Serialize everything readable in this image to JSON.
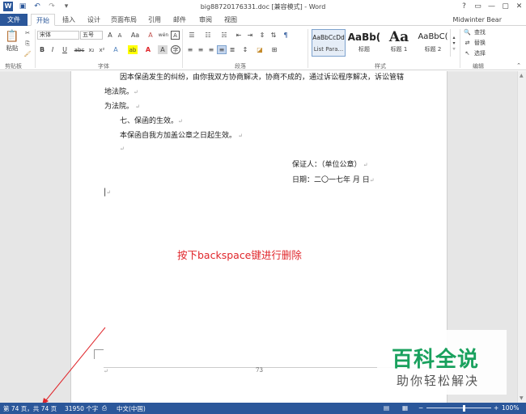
{
  "window": {
    "title": "big88720176331.doc [兼容模式] - Word",
    "controls": [
      "?",
      "▭",
      "—",
      "▢",
      "✕"
    ],
    "user": "Midwinter Bear"
  },
  "tabs": [
    {
      "label": "文件"
    },
    {
      "label": "开始"
    },
    {
      "label": "插入"
    },
    {
      "label": "设计"
    },
    {
      "label": "页面布局"
    },
    {
      "label": "引用"
    },
    {
      "label": "邮件"
    },
    {
      "label": "审阅"
    },
    {
      "label": "视图"
    }
  ],
  "ribbon": {
    "clipboard": {
      "paste": "粘贴",
      "label": "剪贴板"
    },
    "font": {
      "name": "宋体",
      "size": "五号",
      "label": "字体",
      "bold": "B",
      "italic": "I",
      "underline": "U",
      "strike": "abc",
      "sub": "x₂",
      "sup": "x²",
      "grow": "A",
      "shrink": "A",
      "case": "Aa",
      "clear": "A",
      "phonetic": "wén",
      "border": "A"
    },
    "paragraph": {
      "label": "段落"
    },
    "styles": {
      "label": "样式",
      "items": [
        {
          "preview": "AaBbCcDd",
          "name": "List Para..."
        },
        {
          "preview": "AaBb(",
          "name": "标题"
        },
        {
          "preview": "Aa",
          "name": "标题 1"
        },
        {
          "preview": "AaBbC(",
          "name": "标题 2"
        }
      ]
    },
    "editing": {
      "label": "编辑",
      "find": "查找",
      "replace": "替换",
      "select": "选择"
    }
  },
  "document": {
    "lines": [
      "因本保函发生的纠纷，由你我双方协商解决，协商不成的，通过诉讼程序解决，诉讼管辖",
      "地法院。",
      "为法院。",
      "七、保函的生效。",
      "本保函自我方加盖公章之日起生效。",
      "保证人：（单位公章）",
      "日期：二〇一七年    月    日"
    ],
    "page_number": "73"
  },
  "annotation": "按下backspace键进行删除",
  "watermark": {
    "title": "百科全说",
    "subtitle": "助你轻松解决"
  },
  "status": {
    "pages": "第 74 页，共 74 页",
    "words": "31950 个字",
    "language": "中文(中国)",
    "zoom": "100%"
  },
  "colors": {
    "accent": "#2b579a",
    "annotation": "#e0262b",
    "watermark": "#1aa15e"
  }
}
